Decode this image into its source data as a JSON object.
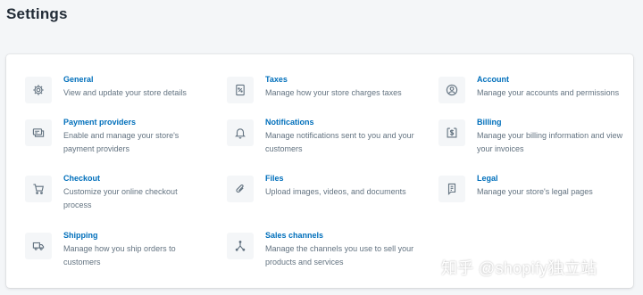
{
  "header": {
    "title": "Settings"
  },
  "settings": {
    "items": [
      {
        "name": "general",
        "icon": "gear-icon",
        "title": "General",
        "description": "View and update your store details"
      },
      {
        "name": "taxes",
        "icon": "tax-receipt-icon",
        "title": "Taxes",
        "description": "Manage how your store charges taxes"
      },
      {
        "name": "account",
        "icon": "user-circle-icon",
        "title": "Account",
        "description": "Manage your accounts and permissions"
      },
      {
        "name": "payment-providers",
        "icon": "payment-card-icon",
        "title": "Payment providers",
        "description": "Enable and manage your store's payment providers"
      },
      {
        "name": "notifications",
        "icon": "bell-icon",
        "title": "Notifications",
        "description": "Manage notifications sent to you and your customers"
      },
      {
        "name": "billing",
        "icon": "billing-dollar-icon",
        "title": "Billing",
        "description": "Manage your billing information and view your invoices"
      },
      {
        "name": "checkout",
        "icon": "cart-icon",
        "title": "Checkout",
        "description": "Customize your online checkout process"
      },
      {
        "name": "files",
        "icon": "paperclip-icon",
        "title": "Files",
        "description": "Upload images, videos, and documents"
      },
      {
        "name": "legal",
        "icon": "legal-document-icon",
        "title": "Legal",
        "description": "Manage your store's legal pages"
      },
      {
        "name": "shipping",
        "icon": "truck-icon",
        "title": "Shipping",
        "description": "Manage how you ship orders to customers"
      },
      {
        "name": "sales-channels",
        "icon": "sales-channels-icon",
        "title": "Sales channels",
        "description": "Manage the channels you use to sell your products and services"
      }
    ]
  },
  "watermark": {
    "text": "知乎 @shopify独立站"
  },
  "colors": {
    "link": "#006fbb",
    "muted": "#637381",
    "icon": "#637381",
    "background": "#f4f6f8"
  }
}
